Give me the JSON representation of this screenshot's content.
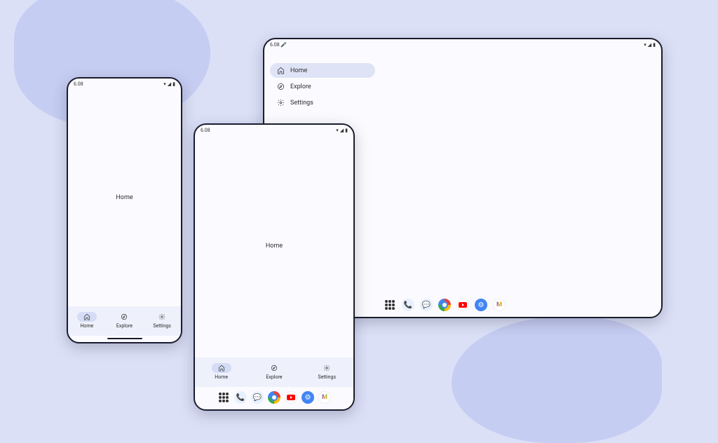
{
  "status": {
    "time": "6.08",
    "icons": {
      "mic": "🎤",
      "wifi": "▾",
      "signal": "◢",
      "battery": "▮"
    }
  },
  "content": {
    "home_label": "Home"
  },
  "nav": {
    "home": "Home",
    "explore": "Explore",
    "settings": "Settings"
  },
  "dock": {
    "apps": "apps",
    "phone": "phone",
    "messages": "messages",
    "chrome": "chrome",
    "youtube": "youtube",
    "settings": "settings",
    "gmail": "gmail"
  }
}
